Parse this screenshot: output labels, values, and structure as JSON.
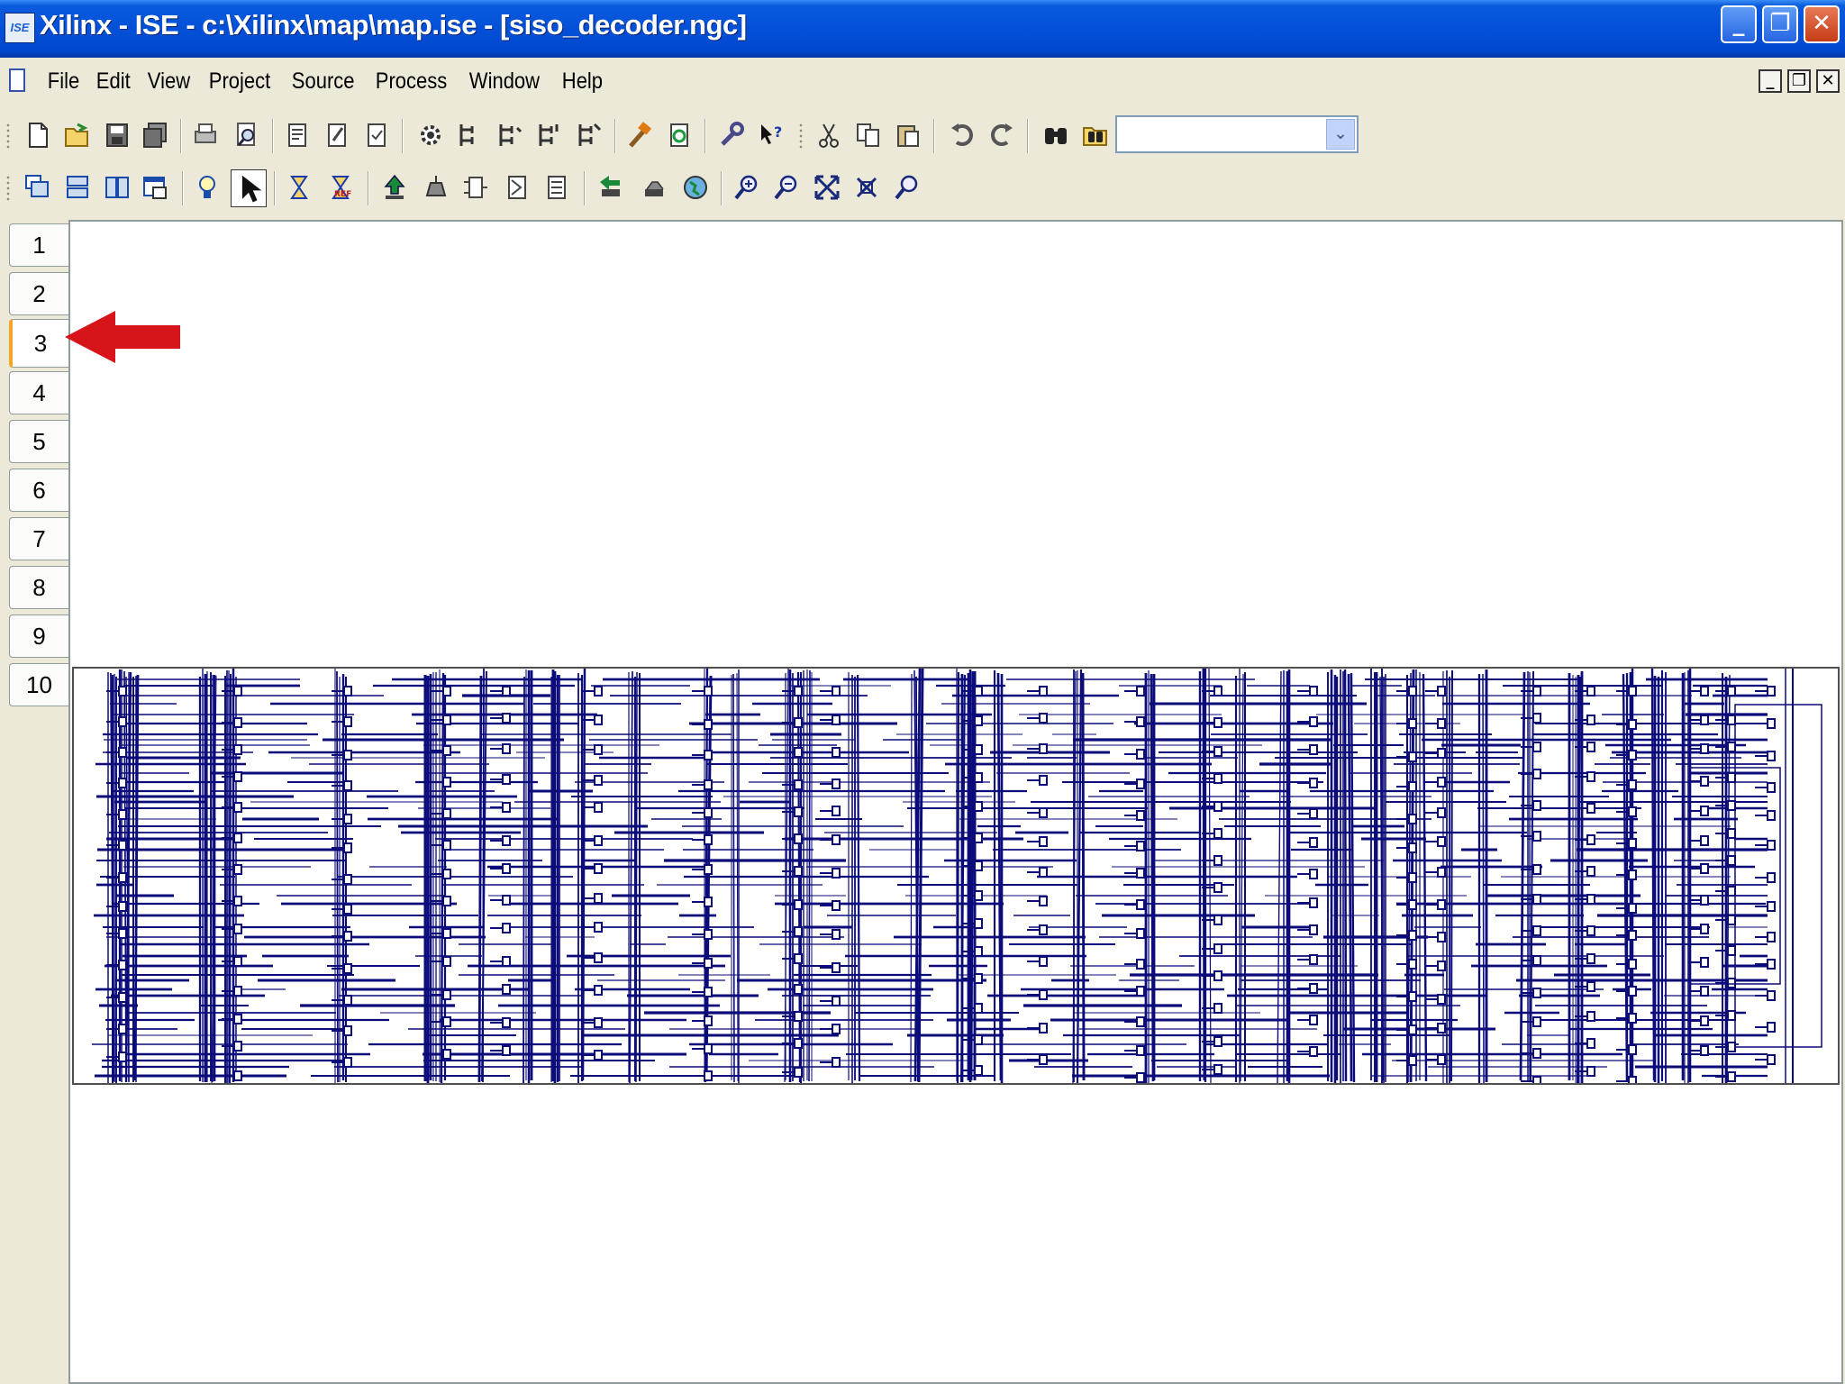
{
  "window": {
    "title": "Xilinx - ISE - c:\\Xilinx\\map\\map.ise - [siso_decoder.ngc]",
    "app_icon_text": "ISE",
    "caption_buttons": {
      "minimize": "_",
      "maximize": "❐",
      "close": "✕"
    }
  },
  "menu": {
    "items": [
      "File",
      "Edit",
      "View",
      "Project",
      "Source",
      "Process",
      "Window",
      "Help"
    ],
    "mdi_buttons": {
      "minimize": "_",
      "restore": "❐",
      "close": "✕"
    }
  },
  "toolbar1": {
    "icons": [
      "new-file-icon",
      "open-folder-icon",
      "save-icon",
      "save-all-icon",
      "print-icon",
      "print-preview-icon",
      "edit-doc-icon",
      "edit-doc2-icon",
      "check-doc-icon",
      "gear-icon",
      "hierarchy-icon",
      "hierarchy2-icon",
      "hierarchy3-icon",
      "hierarchy4-icon",
      "hammer-icon",
      "refresh-icon",
      "wrench-icon",
      "help-cursor-icon",
      "cut-icon",
      "copy-icon",
      "paste-icon",
      "undo-icon",
      "redo-icon",
      "binoculars-icon",
      "find-in-files-icon"
    ],
    "search_value": ""
  },
  "toolbar2": {
    "icons": [
      "cascade-icon",
      "tile-horizontal-icon",
      "tile-vertical-icon",
      "window-icon",
      "lightbulb-icon",
      "select-arrow-icon",
      "hourglass-icon",
      "hourglass-ref-icon",
      "push-up-icon",
      "pop-down-icon",
      "block-icon",
      "block2-icon",
      "block3-icon",
      "back-icon",
      "forward-icon",
      "globe-icon",
      "zoom-in-icon",
      "zoom-out-icon",
      "zoom-full-icon",
      "zoom-fit-icon",
      "zoom-select-icon"
    ]
  },
  "sheet_tabs": [
    "1",
    "2",
    "3",
    "4",
    "5",
    "6",
    "7",
    "8",
    "9",
    "10"
  ],
  "active_sheet": "3",
  "colors": {
    "wire": "#0B0B7A",
    "arrow": "#D7141A",
    "titlebar": "#0350D8"
  }
}
